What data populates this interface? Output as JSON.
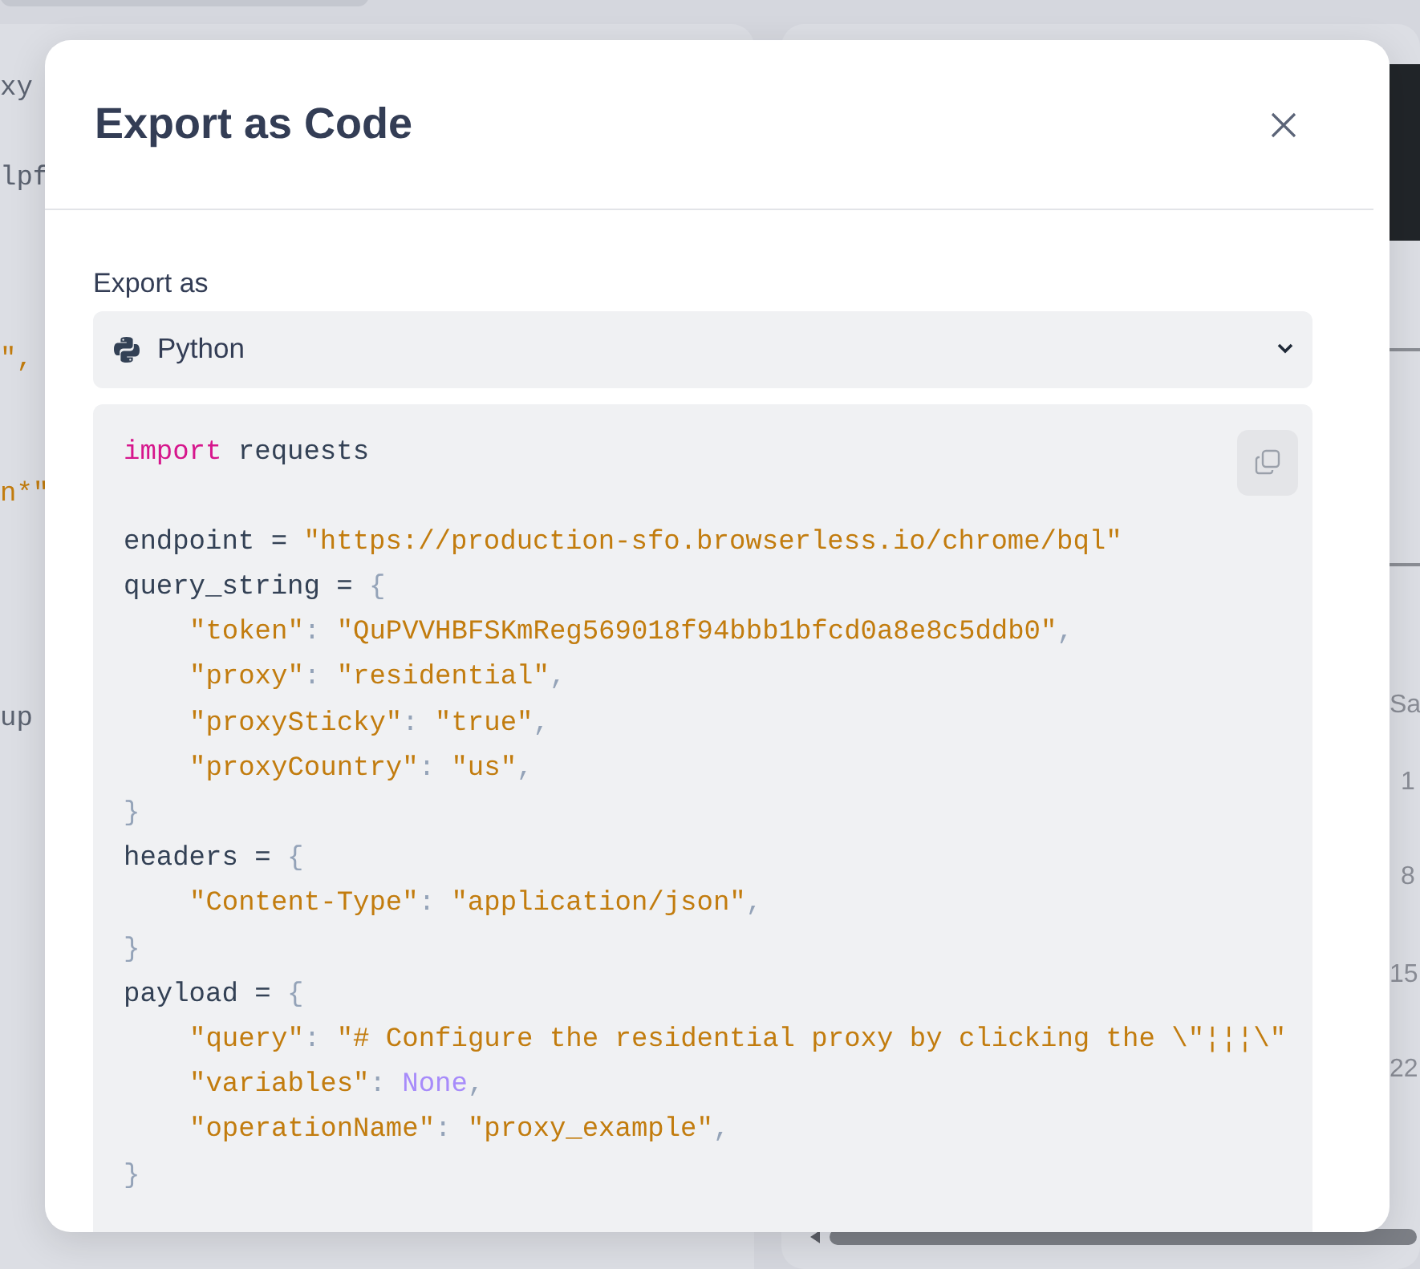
{
  "background": {
    "left_fragments": [
      {
        "text": "xy",
        "kind": "plain"
      },
      {
        "text": "lpf",
        "kind": "plain"
      },
      {
        "text": "\",",
        "kind": "string"
      },
      {
        "text": "n*\"",
        "kind": "string"
      },
      {
        "text": "up",
        "kind": "plain"
      }
    ],
    "right_fragments": [
      {
        "text": "Sa",
        "kind": "header"
      },
      {
        "text": "1",
        "kind": "day"
      },
      {
        "text": "8",
        "kind": "day"
      },
      {
        "text": "15",
        "kind": "day"
      },
      {
        "text": "22",
        "kind": "day"
      }
    ]
  },
  "modal": {
    "title": "Export as Code",
    "export_label": "Export as",
    "language_select": {
      "value": "Python"
    },
    "code": {
      "lines": [
        {
          "kind": "code",
          "indent": false,
          "tokens": [
            {
              "kind": "keyword",
              "text": "import"
            },
            {
              "kind": "name",
              "text": " requests"
            }
          ]
        },
        {
          "kind": "blank"
        },
        {
          "kind": "code",
          "indent": false,
          "tokens": [
            {
              "kind": "name",
              "text": "endpoint = "
            },
            {
              "kind": "string",
              "text": "\"https://production-sfo.browserless.io/chrome/bql\""
            }
          ]
        },
        {
          "kind": "code",
          "indent": false,
          "tokens": [
            {
              "kind": "name",
              "text": "query_string = "
            },
            {
              "kind": "punct",
              "text": "{"
            }
          ]
        },
        {
          "kind": "code",
          "indent": true,
          "tokens": [
            {
              "kind": "string",
              "text": "\"token\""
            },
            {
              "kind": "punct",
              "text": ": "
            },
            {
              "kind": "string",
              "text": "\"QuPVVHBFSKmReg569018f94bbb1bfcd0a8e8c5ddb0\""
            },
            {
              "kind": "punct",
              "text": ","
            }
          ]
        },
        {
          "kind": "code",
          "indent": true,
          "tokens": [
            {
              "kind": "string",
              "text": "\"proxy\""
            },
            {
              "kind": "punct",
              "text": ": "
            },
            {
              "kind": "string",
              "text": "\"residential\""
            },
            {
              "kind": "punct",
              "text": ","
            }
          ]
        },
        {
          "kind": "code",
          "indent": true,
          "tokens": [
            {
              "kind": "string",
              "text": "\"proxySticky\""
            },
            {
              "kind": "punct",
              "text": ": "
            },
            {
              "kind": "string",
              "text": "\"true\""
            },
            {
              "kind": "punct",
              "text": ","
            }
          ]
        },
        {
          "kind": "code",
          "indent": true,
          "tokens": [
            {
              "kind": "string",
              "text": "\"proxyCountry\""
            },
            {
              "kind": "punct",
              "text": ": "
            },
            {
              "kind": "string",
              "text": "\"us\""
            },
            {
              "kind": "punct",
              "text": ","
            }
          ]
        },
        {
          "kind": "code",
          "indent": false,
          "tokens": [
            {
              "kind": "punct",
              "text": "}"
            }
          ]
        },
        {
          "kind": "code",
          "indent": false,
          "tokens": [
            {
              "kind": "name",
              "text": "headers = "
            },
            {
              "kind": "punct",
              "text": "{"
            }
          ]
        },
        {
          "kind": "code",
          "indent": true,
          "tokens": [
            {
              "kind": "string",
              "text": "\"Content-Type\""
            },
            {
              "kind": "punct",
              "text": ": "
            },
            {
              "kind": "string",
              "text": "\"application/json\""
            },
            {
              "kind": "punct",
              "text": ","
            }
          ]
        },
        {
          "kind": "code",
          "indent": false,
          "tokens": [
            {
              "kind": "punct",
              "text": "}"
            }
          ]
        },
        {
          "kind": "code",
          "indent": false,
          "tokens": [
            {
              "kind": "name",
              "text": "payload = "
            },
            {
              "kind": "punct",
              "text": "{"
            }
          ]
        },
        {
          "kind": "code",
          "indent": true,
          "tokens": [
            {
              "kind": "string",
              "text": "\"query\""
            },
            {
              "kind": "punct",
              "text": ": "
            },
            {
              "kind": "string",
              "text": "\"# Configure the residential proxy by clicking the \\\"¦¦¦\\\""
            }
          ]
        },
        {
          "kind": "code",
          "indent": true,
          "tokens": [
            {
              "kind": "string",
              "text": "\"variables\""
            },
            {
              "kind": "punct",
              "text": ": "
            },
            {
              "kind": "constant",
              "text": "None"
            },
            {
              "kind": "punct",
              "text": ","
            }
          ]
        },
        {
          "kind": "code",
          "indent": true,
          "tokens": [
            {
              "kind": "string",
              "text": "\"operationName\""
            },
            {
              "kind": "punct",
              "text": ": "
            },
            {
              "kind": "string",
              "text": "\"proxy_example\""
            },
            {
              "kind": "punct",
              "text": ","
            }
          ]
        },
        {
          "kind": "code",
          "indent": false,
          "tokens": [
            {
              "kind": "punct",
              "text": "}"
            }
          ]
        }
      ]
    }
  }
}
